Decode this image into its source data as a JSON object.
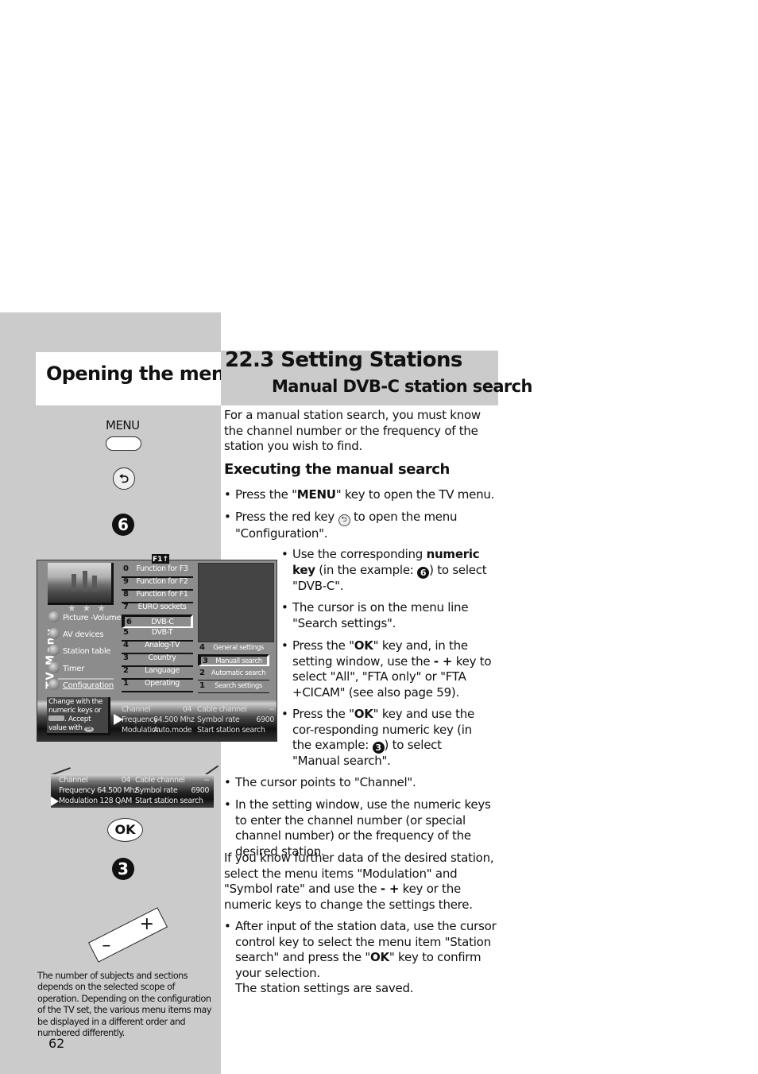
{
  "left_column": {
    "title": "Opening the menu",
    "menu_key_label": "MENU",
    "back_key_glyph": "⮌",
    "numeric_key_1": "6",
    "ok_key_label": "OK",
    "numeric_key_2": "3",
    "minus_glyph": "–",
    "plus_glyph": "+",
    "footnote": "The number of subjects and sections depends on the selected scope of operation. Depending on the configuration of the TV set, the various menu items may be displayed in a different order and numbered differently.",
    "page_number": "62"
  },
  "header": {
    "title": "22.3 Setting Stations",
    "subtitle": "Manual DVB-C station search"
  },
  "intro": "For a manual station search, you must know the channel number or the frequency of the station you wish to find.",
  "section_heading": "Executing the manual search",
  "steps": {
    "s1_pre": "Press the \"",
    "s1_bold": "MENU",
    "s1_post": "\" key to open the TV menu.",
    "s2_pre": "Press the red key ",
    "s2_post": " to open the menu \"Configuration\".",
    "s3_pre": "Use the corresponding ",
    "s3_bold": "numeric key",
    "s3_mid": " (in the example: ",
    "s3_num": "6",
    "s3_post": ") to select \"DVB-C\".",
    "s4": "The cursor is on the menu line \"Search settings\".",
    "s5_pre": "Press the \"",
    "s5_bold": "OK",
    "s5_mid": "\" key and, in the setting window, use the ",
    "s5_key": "- +",
    "s5_post": " key to select \"All\", \"FTA only\" or \"FTA +CICAM\" (see also page 59).",
    "s6_pre": "Press the \"",
    "s6_bold": "OK",
    "s6_mid": "\" key and use the cor-responding numeric key (in the example: ",
    "s6_num": "3",
    "s6_post": ") to select \"Manual search\".",
    "s7": "The cursor points to \"Channel\".",
    "s8": "In the setting window, use the numeric keys to enter the channel number (or special channel number) or the frequency  of the desired station.",
    "para_pre": "If you know further data of the desired station, select the menu items \"Modulation\" and \"Symbol rate\" and use the ",
    "para_key": "- +",
    "para_post": " key or the numeric keys to change the settings there.",
    "s9_pre": "After input of the station data, use the cursor control key to select the menu item \"Station search\" and press the \"",
    "s9_bold": "OK",
    "s9_post": "\" key to confirm your selection.",
    "s9_note": "The station settings are saved."
  },
  "tv_menu": {
    "vertical_title": "TV-Menu",
    "stars": "★ ★ ★",
    "f1_tag": "F1↑",
    "main_items": [
      "Picture -Volume",
      "AV devices",
      "Station table",
      "Timer",
      "Configuration"
    ],
    "config_items": [
      {
        "num": "0",
        "label": "Function for F3"
      },
      {
        "num": "9",
        "label": "Function for F2"
      },
      {
        "num": "8",
        "label": "Function for F1"
      },
      {
        "num": "7",
        "label": "EURO sockets"
      },
      {
        "num": "6",
        "label": "DVB-C"
      },
      {
        "num": "5",
        "label": "DVB-T"
      },
      {
        "num": "4",
        "label": "Analog-TV"
      },
      {
        "num": "3",
        "label": "Country"
      },
      {
        "num": "2",
        "label": "Language"
      },
      {
        "num": "1",
        "label": "Operating"
      }
    ],
    "dvbc_items": [
      {
        "num": "4",
        "label": "General settings"
      },
      {
        "num": "3",
        "label": "Manuall search"
      },
      {
        "num": "2",
        "label": "Automatic search"
      },
      {
        "num": "1",
        "label": "Search settings"
      }
    ],
    "help": {
      "line1": "Change with the",
      "line2": "numeric keys or",
      "line3": ". Accept",
      "line4": "value with",
      "ok": "OK"
    },
    "params": {
      "channel_label": "Channel",
      "channel_value": "04",
      "cable_label": "Cable channel",
      "cable_value": "--",
      "freq_label": "Frequency",
      "freq_value": "64.500 Mhz",
      "symbol_label": "Symbol rate",
      "symbol_value": "6900",
      "mod_label": "Modulation",
      "mod_value": "Auto.mode",
      "start_label": "Start station search"
    }
  },
  "setting_window": {
    "channel_label": "Channel",
    "channel_value": "04",
    "cable_label": "Cable channel",
    "cable_value": "--",
    "freq_label": "Frequency 64.500 Mhz",
    "symbol_label": "Symbol rate",
    "symbol_value": "6900",
    "mod_label": "Modulation 128 QAM",
    "start_label": "Start station search"
  }
}
